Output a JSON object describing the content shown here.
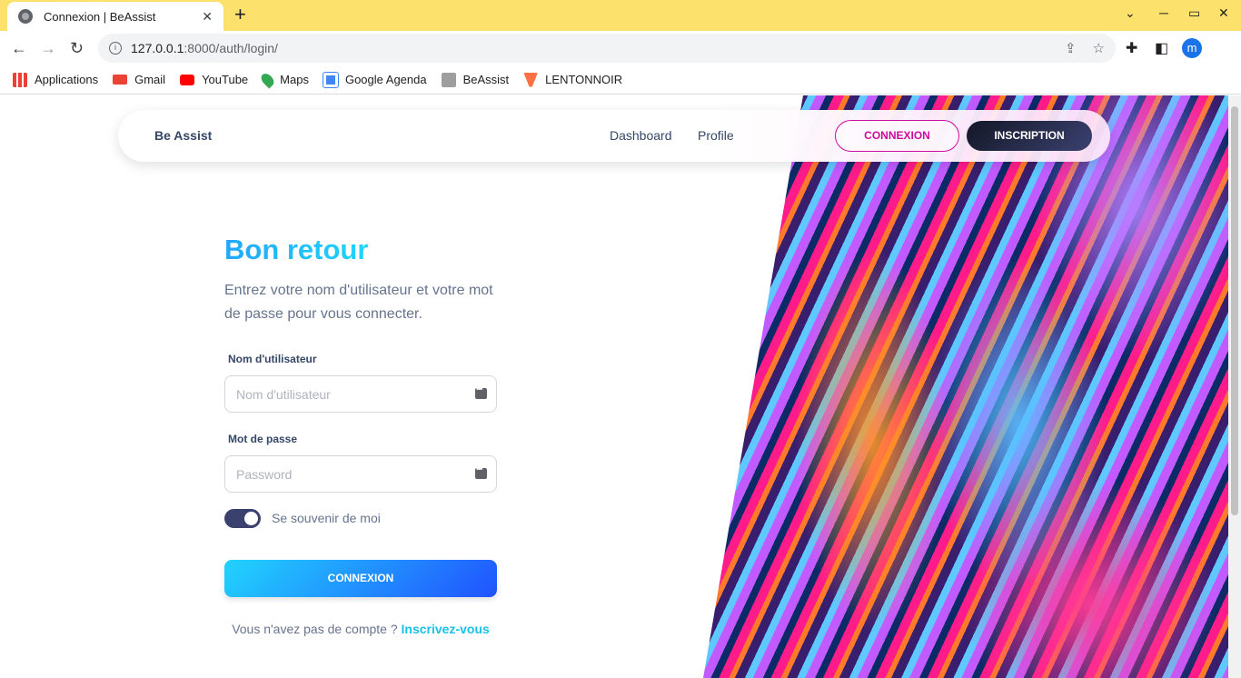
{
  "browser": {
    "tab_title": "Connexion | BeAssist",
    "tab_close": "✕",
    "new_tab": "+",
    "url_host": "127.0.0.1",
    "url_rest": ":8000/auth/login/",
    "minimize": "─",
    "maximize": "▭",
    "close": "✕",
    "chevron": "⌄",
    "profile_initial": "m"
  },
  "bookmarks": [
    {
      "label": "Applications",
      "color": "#ea4335"
    },
    {
      "label": "Gmail",
      "color": "#ea4335"
    },
    {
      "label": "YouTube",
      "color": "#ff0000"
    },
    {
      "label": "Maps",
      "color": "#34a853"
    },
    {
      "label": "Google Agenda",
      "color": "#4285f4"
    },
    {
      "label": "BeAssist",
      "color": "#9e9e9e"
    },
    {
      "label": "LENTONNOIR",
      "color": "#ff7043"
    }
  ],
  "navbar": {
    "brand": "Be Assist",
    "links": [
      "Dashboard",
      "Profile"
    ],
    "connexion": "CONNEXION",
    "inscription": "INSCRIPTION"
  },
  "form": {
    "heading": "Bon retour",
    "subtitle": "Entrez votre nom d'utilisateur et votre mot de passe pour vous connecter.",
    "username_label": "Nom d'utilisateur",
    "username_placeholder": "Nom d'utilisateur",
    "password_label": "Mot de passe",
    "password_placeholder": "Password",
    "remember_label": "Se souvenir de moi",
    "remember_checked": true,
    "submit": "CONNEXION",
    "signup_text": "Vous n'avez pas de compte ?",
    "signup_link": "Inscrivez-vous"
  },
  "colors": {
    "accent": "#21d4fd",
    "brand_pink": "#cb0c9f",
    "dark": "#344767"
  }
}
